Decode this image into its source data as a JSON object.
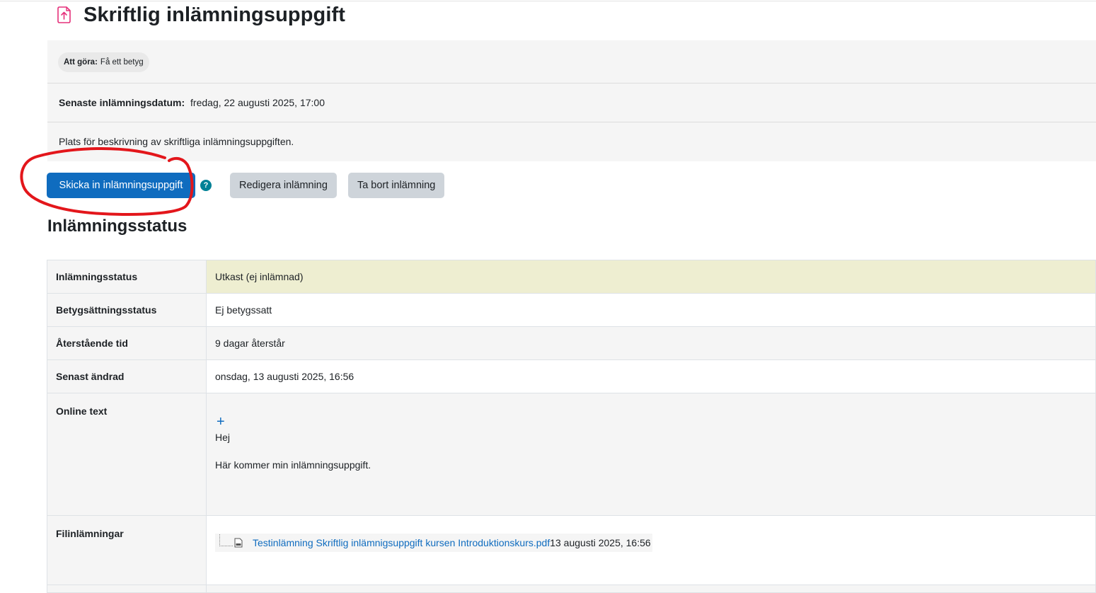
{
  "activity": {
    "icon": "assignment-upload-icon",
    "title": "Skriftlig inlämningsuppgift"
  },
  "intro": {
    "todo_label": "Att göra:",
    "todo_value": "Få ett betyg",
    "due_label": "Senaste inlämningsdatum:",
    "due_value": "fredag, 22 augusti 2025, 17:00",
    "description": "Plats för beskrivning av skriftliga inlämningsuppgiften."
  },
  "actions": {
    "submit_label": "Skicka in inlämningsuppgift",
    "help_glyph": "?",
    "edit_label": "Redigera inlämning",
    "remove_label": "Ta bort inlämning"
  },
  "annotation": {
    "color": "#e3161b"
  },
  "status": {
    "heading": "Inlämningsstatus",
    "rows": [
      {
        "label": "Inlämningsstatus",
        "value": "Utkast (ej inlämnad)"
      },
      {
        "label": "Betygsättningsstatus",
        "value": "Ej betygssatt"
      },
      {
        "label": "Återstående tid",
        "value": "9 dagar återstår"
      },
      {
        "label": "Senast ändrad",
        "value": "onsdag, 13 augusti 2025, 16:56"
      }
    ],
    "online_text": {
      "label": "Online text",
      "expand_glyph": "+",
      "heading": "Hej",
      "body": "Här kommer min inlämningsuppgift."
    },
    "file_submissions": {
      "label": "Filinlämningar",
      "file_name": "Testinlämning Skriftlig inlämnigsuppgift kursen Introduktionskurs.pdf",
      "file_date": "13 augusti 2025, 16:56"
    }
  },
  "colors": {
    "primary": "#0f6cbf",
    "secondary": "#ced4da",
    "draft_bg": "#eeeed1",
    "activity_icon": "#e5307a",
    "help": "#008196"
  }
}
